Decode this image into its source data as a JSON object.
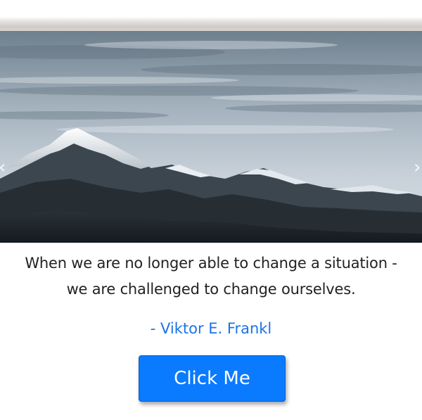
{
  "carousel": {
    "image": "snowy-mountain-range-landscape",
    "prev_icon": "chevron-left-icon",
    "next_icon": "chevron-right-icon",
    "prev_glyph": "‹",
    "next_glyph": "›"
  },
  "quote": {
    "line1": "When we are no longer able to change a situation -",
    "line2": "we are challenged to change ourselves.",
    "author": "- Viktor E. Frankl"
  },
  "cta": {
    "label": "Click Me"
  },
  "colors": {
    "accent": "#0a7bff",
    "author_text": "#1a73e8",
    "quote_text": "#222222"
  }
}
